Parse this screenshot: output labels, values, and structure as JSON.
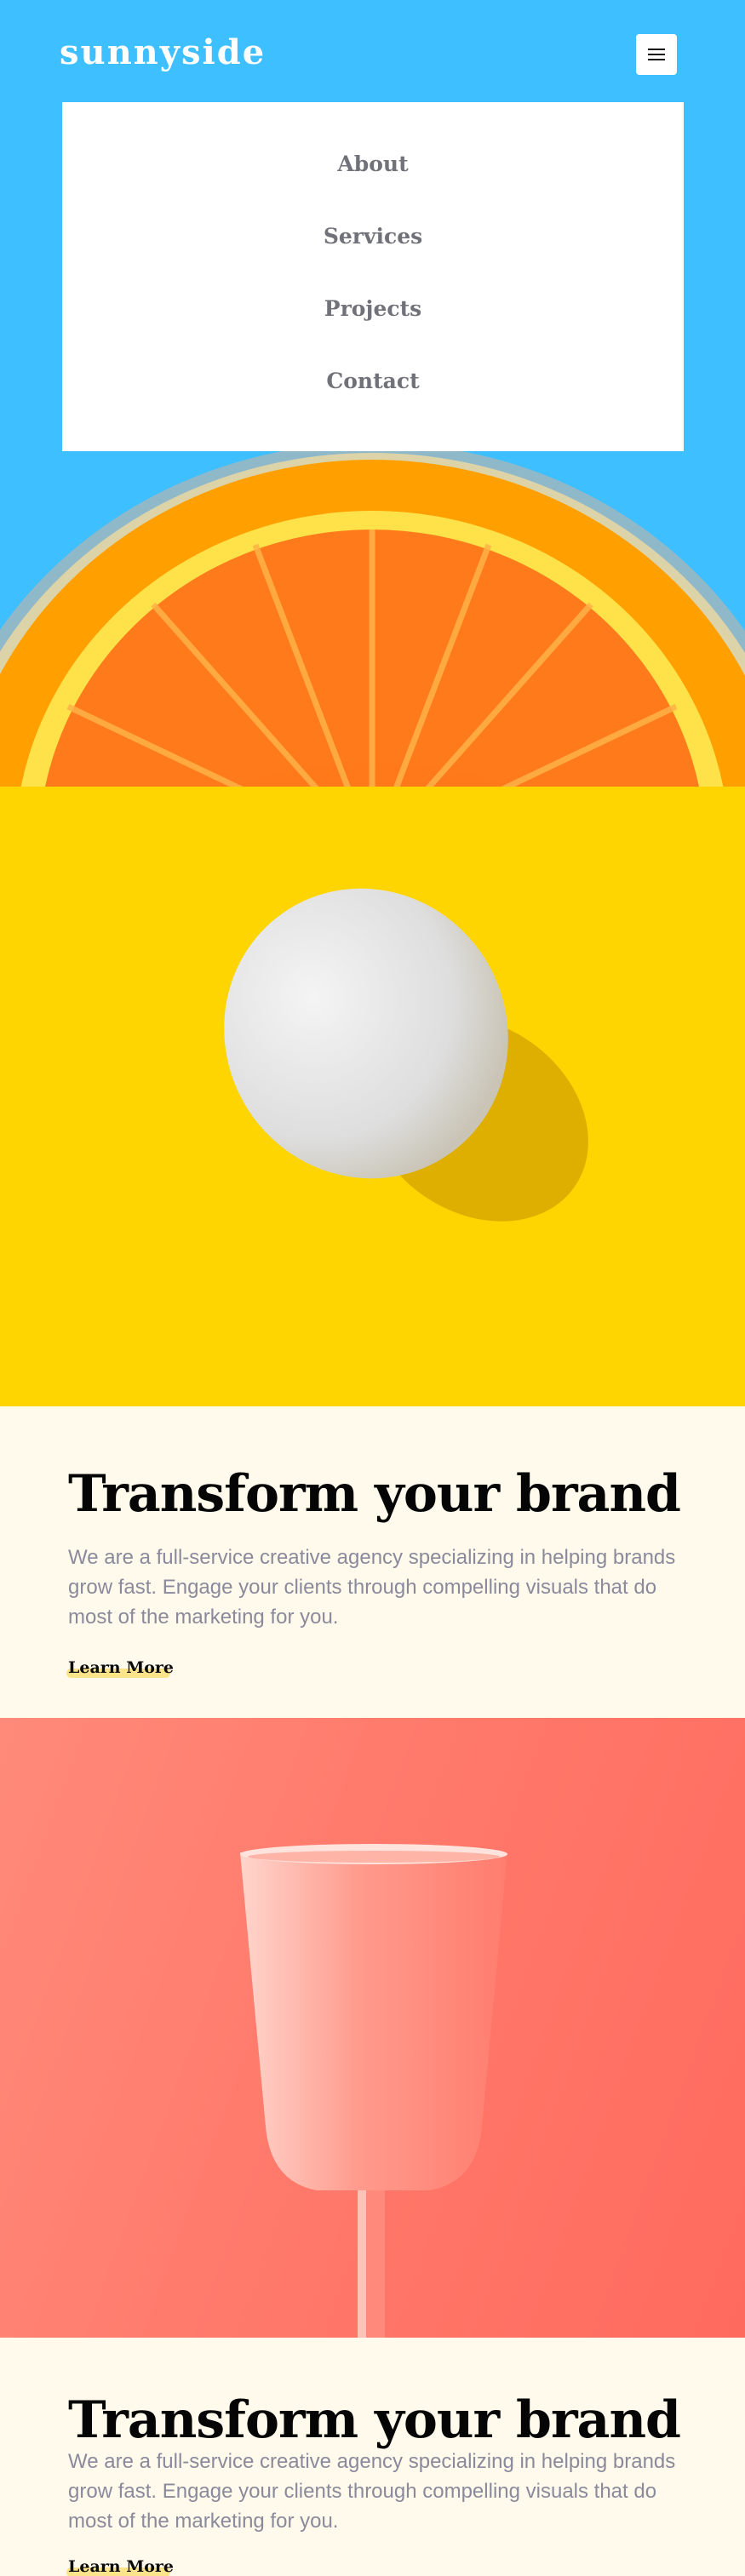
{
  "header": {
    "logo": "sunnyside",
    "menu_icon": "hamburger-icon"
  },
  "nav": {
    "items": [
      {
        "label": "About"
      },
      {
        "label": "Services"
      },
      {
        "label": "Projects"
      },
      {
        "label": "Contact"
      }
    ]
  },
  "sections": [
    {
      "title": "Transform your brand",
      "body": "We are a full-service creative agency specializing in helping brands grow fast. Engage your clients through compelling visuals that do most of the marketing for you.",
      "cta": "Learn More"
    },
    {
      "title": "Transform your brand",
      "body": "We are a full-service creative agency specializing in helping brands grow fast. Engage your clients through compelling visuals that do most of the marketing for you.",
      "cta": "Learn More"
    }
  ],
  "colors": {
    "hero_bg": "#3ebfff",
    "egg_bg": "#fed500",
    "text_bg": "#fffaeb",
    "cup_bg": "#ff7a6b",
    "cta_underline": "#fad23c"
  }
}
